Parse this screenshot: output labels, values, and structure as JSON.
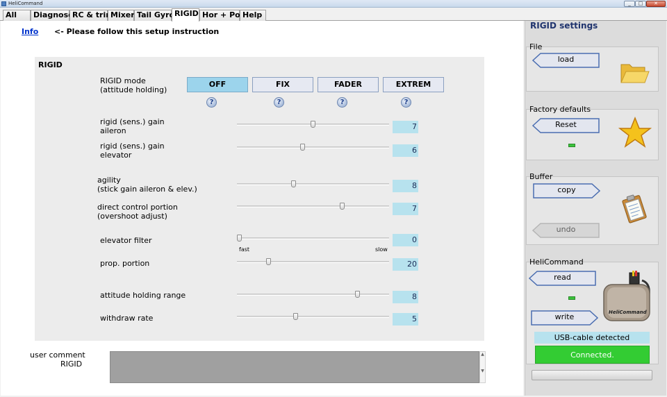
{
  "window": {
    "title": "HeliCommand"
  },
  "tabs": [
    "All",
    "Diagnose",
    "RC & trim",
    "Mixer",
    "Tail Gyro",
    "RIGID",
    "Hor + Pos",
    "Help"
  ],
  "header": {
    "info_link": "Info",
    "info_text": "<- Please follow this setup instruction"
  },
  "rigid": {
    "title": "RIGID",
    "mode_label_1": "RIGID  mode",
    "mode_label_2": "(attitude holding)",
    "modes": [
      "OFF",
      "FIX",
      "FADER",
      "EXTREM"
    ],
    "selected_mode": "OFF",
    "help_glyph": "?",
    "sliders": [
      {
        "label_1": "rigid  (sens.) gain",
        "label_2": "aileron",
        "value": "7"
      },
      {
        "label_1": "rigid  (sens.) gain",
        "label_2": "elevator",
        "value": "6"
      },
      {
        "label_1": "agility",
        "label_2": "(stick gain aileron & elev.)",
        "value": "8"
      },
      {
        "label_1": "direct control portion",
        "label_2": "(overshoot adjust)",
        "value": "7"
      },
      {
        "label_1": "elevator filter",
        "label_2": "",
        "value": "0"
      },
      {
        "label_1": "prop. portion",
        "label_2": "",
        "value": "20"
      },
      {
        "label_1": "attitude holding range",
        "label_2": "",
        "value": "8"
      },
      {
        "label_1": "withdraw rate",
        "label_2": "",
        "value": "5"
      }
    ],
    "slider_fractions": [
      0.5,
      0.43,
      0.37,
      0.7,
      0.0,
      0.2,
      0.8,
      0.38
    ],
    "filter_fast": "fast",
    "filter_slow": "slow"
  },
  "comment": {
    "label": "user comment",
    "sublabel": "RIGID",
    "value": ""
  },
  "settings": {
    "title": "RIGID settings",
    "file": {
      "label": "File",
      "load": "load",
      "icon": "folder-icon"
    },
    "factory": {
      "label": "Factory defaults",
      "reset": "Reset",
      "icon": "star-icon"
    },
    "buffer": {
      "label": "Buffer",
      "copy": "copy",
      "undo": "undo",
      "icon": "clipboard-icon"
    },
    "helicommand": {
      "label": "HeliCommand",
      "read": "read",
      "write": "write",
      "device_text": "HeliCommand",
      "icon": "device-icon"
    },
    "usb_status": "USB-cable detected",
    "connection_status": "Connected."
  },
  "colors": {
    "selected_mode": "#9cd4ec",
    "value_box": "#b7e2ee",
    "connected": "#33cc33",
    "accent_text": "#20346e"
  }
}
